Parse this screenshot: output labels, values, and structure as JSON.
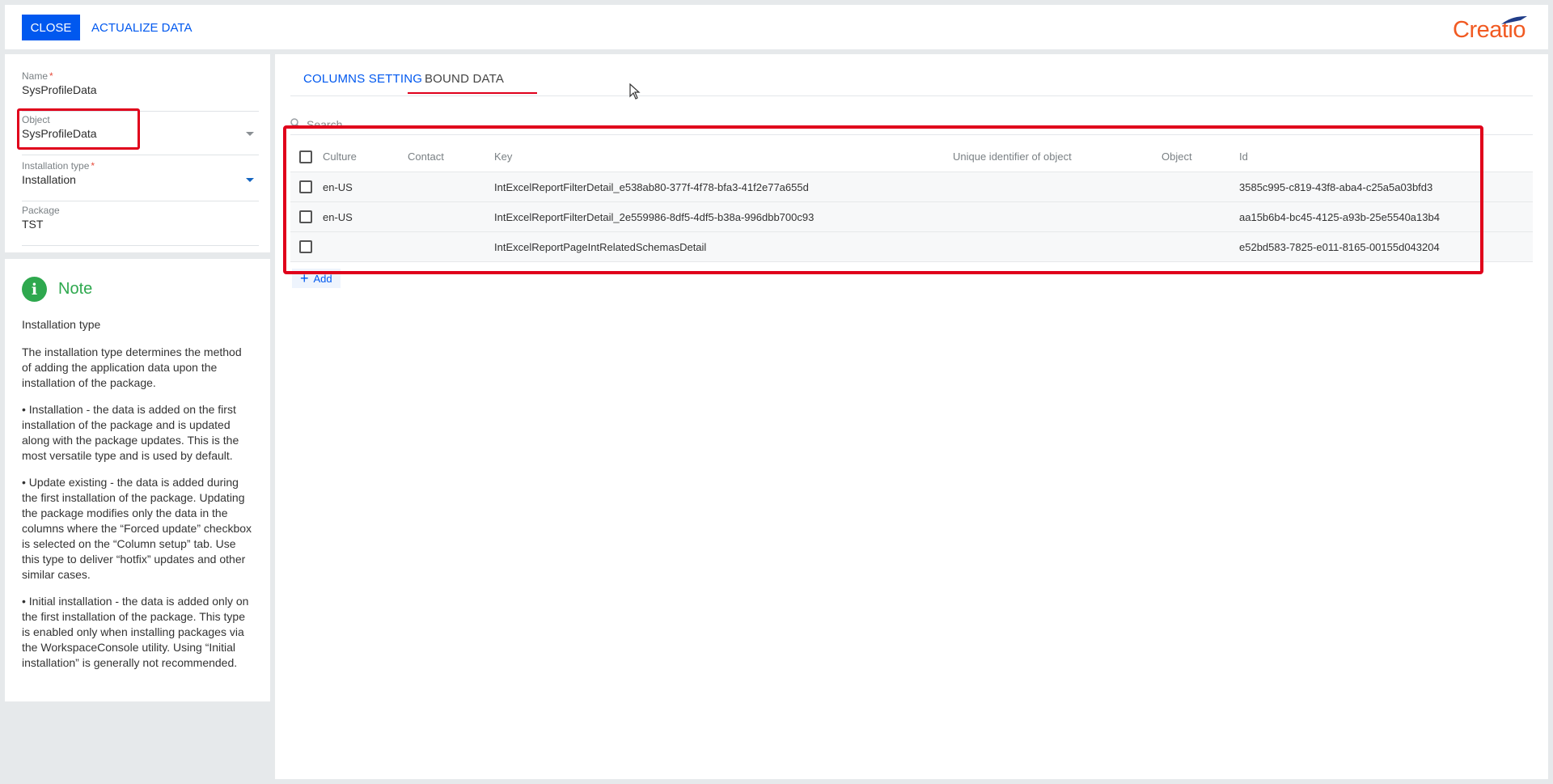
{
  "toolbar": {
    "close_label": "CLOSE",
    "actualize_label": "ACTUALIZE DATA",
    "logo_text": "Creatio"
  },
  "form": {
    "name": {
      "label": "Name",
      "required": "*",
      "value": "SysProfileData"
    },
    "object": {
      "label": "Object",
      "value": "SysProfileData"
    },
    "installation_type": {
      "label": "Installation type",
      "required": "*",
      "value": "Installation"
    },
    "package": {
      "label": "Package",
      "value": "TST"
    }
  },
  "note": {
    "icon": "i",
    "title": "Note",
    "subtitle": "Installation type",
    "paragraphs": [
      "The installation type determines the method of adding the application data upon the installation of the package.",
      "• Installation - the data is added on the first installation of the package and is updated along with the package updates. This is the most versatile type and is used by default.",
      "• Update existing - the data is added during the first installation of the package. Updating the package modifies only the data in the columns where the “Forced update” checkbox is selected on the “Column setup” tab. Use this type to deliver “hotfix” updates and other similar cases.",
      "• Initial installation - the data is added only on the first installation of the package. This type is enabled only when installing packages via the WorkspaceConsole utility. Using “Initial installation” is generally not recommended."
    ]
  },
  "tabs": {
    "columns_setting": "COLUMNS SETTING",
    "bound_data": "BOUND DATA"
  },
  "search": {
    "placeholder": "Search"
  },
  "grid": {
    "columns": {
      "culture": "Culture",
      "contact": "Contact",
      "key": "Key",
      "uid": "Unique identifier of object",
      "object": "Object",
      "id": "Id"
    },
    "rows": [
      {
        "culture": "en-US",
        "contact": "",
        "key": "IntExcelReportFilterDetail_e538ab80-377f-4f78-bfa3-41f2e77a655d",
        "uid": "",
        "object": "",
        "id": "3585c995-c819-43f8-aba4-c25a5a03bfd3"
      },
      {
        "culture": "en-US",
        "contact": "",
        "key": "IntExcelReportFilterDetail_2e559986-8df5-4df5-b38a-996dbb700c93",
        "uid": "",
        "object": "",
        "id": "aa15b6b4-bc45-4125-a93b-25e5540a13b4"
      },
      {
        "culture": "",
        "contact": "",
        "key": "IntExcelReportPageIntRelatedSchemasDetail",
        "uid": "",
        "object": "",
        "id": "e52bd583-7825-e011-8165-00155d043204"
      }
    ]
  },
  "add_button": {
    "label": "Add"
  },
  "colors": {
    "accent": "#0058ef",
    "highlight": "#e0001b",
    "brand": "#f15a22",
    "note": "#2ea84e"
  }
}
